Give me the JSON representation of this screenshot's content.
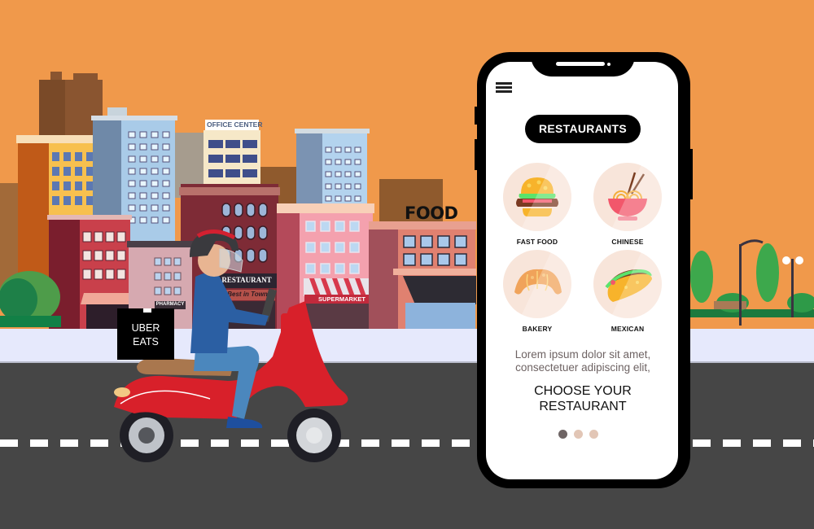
{
  "scene": {
    "colors": {
      "sky": "#F0994B",
      "sidewalk": "#E6E9FC",
      "road": "#464646",
      "lane_marking": "#FFFFFF"
    },
    "signs": {
      "office_center": "OFFICE CENTER",
      "restaurant": "RESTAURANT",
      "best_in_town": "Best in Town",
      "pharmacy": "PHARMACY",
      "supermarket": "SUPERMARKET",
      "food": "FOOD"
    },
    "delivery_box": {
      "line1": "UBER",
      "line2": "EATS"
    }
  },
  "phone": {
    "menu_icon": "hamburger-menu-icon",
    "header_button": "RESTAURANTS",
    "categories": [
      {
        "label": "FAST FOOD",
        "icon": "burger-icon"
      },
      {
        "label": "CHINESE",
        "icon": "noodle-bowl-icon"
      },
      {
        "label": "BAKERY",
        "icon": "croissant-icon"
      },
      {
        "label": "MEXICAN",
        "icon": "taco-icon"
      }
    ],
    "description": "Lorem ipsum dolor sit amet, consectetuer adipiscing elit,",
    "headline_line1": "CHOOSE YOUR",
    "headline_line2": "RESTAURANT",
    "pagination": {
      "total": 3,
      "active": 1
    },
    "colors": {
      "accent": "#000000",
      "category_bg": "#F8E5DA",
      "dot_active": "#6F6565",
      "dot_inactive": "#E2C6B6"
    }
  }
}
